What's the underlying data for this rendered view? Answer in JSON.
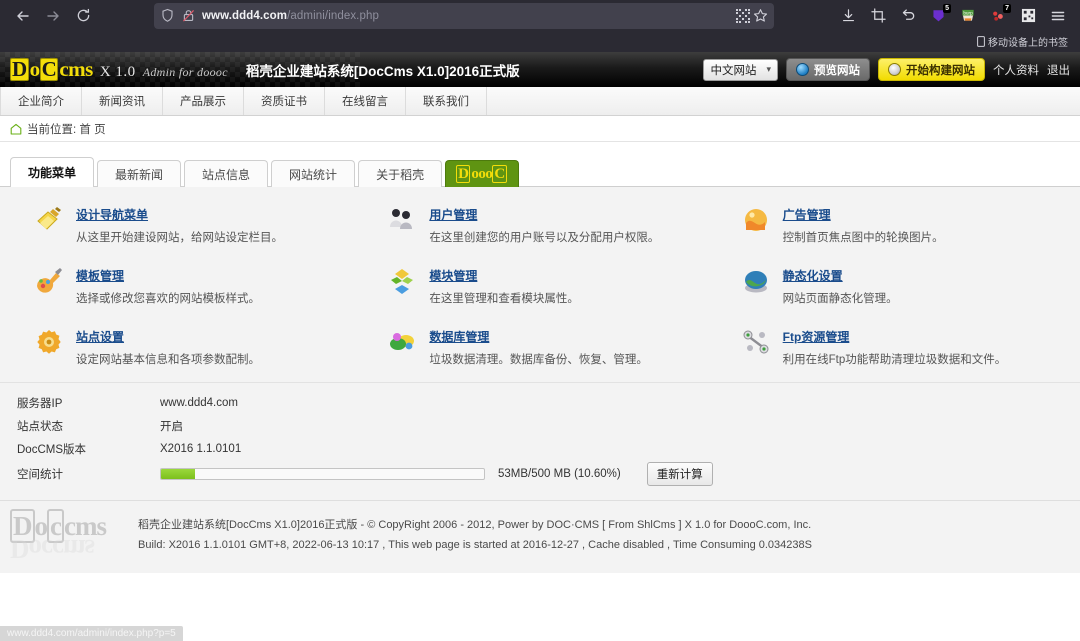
{
  "browser": {
    "back_icon": "back-arrow-icon",
    "forward_icon": "forward-arrow-icon",
    "reload_icon": "reload-icon",
    "url_display_bold": "www.ddd4.com",
    "url_display_rest": "/admini/index.php",
    "url_full": "www.ddd4.com/admini/index.php",
    "shield_icon": "shield-icon",
    "insecure_lock_icon": "lock-crossed-icon",
    "qr_icon": "qr-code-icon",
    "bookmark_star_icon": "star-icon",
    "toolbar_icons": [
      {
        "name": "downloads-icon",
        "badge": ""
      },
      {
        "name": "screenshot-crop-icon",
        "badge": ""
      },
      {
        "name": "undo-arrow-icon",
        "badge": ""
      },
      {
        "name": "extension-purple-icon",
        "badge": "5"
      },
      {
        "name": "burp-extension-icon",
        "badge": ""
      },
      {
        "name": "extension-red-icon",
        "badge": "7"
      },
      {
        "name": "qr-extension-icon",
        "badge": ""
      },
      {
        "name": "hamburger-menu-icon",
        "badge": ""
      }
    ],
    "bookmark_label": "移动设备上的书签",
    "status_url": "www.ddd4.com/admini/index.php?p=5"
  },
  "header": {
    "logo_d": "D",
    "logo_o": "o",
    "logo_c": "C",
    "logo_cms": "cms",
    "version": "X 1.0",
    "subtitle": "Admin for doooc",
    "title": "稻壳企业建站系统[DocCms X1.0]2016正式版",
    "lang_select": "中文网站",
    "lang_caret": "▾",
    "preview_button": "预览网站",
    "build_button": "开始构建网站",
    "profile_link": "个人资料",
    "logout_link": "退出",
    "accent_yellow": "#f3dd0a"
  },
  "site_nav": {
    "items": [
      {
        "label": "企业简介"
      },
      {
        "label": "新闻资讯"
      },
      {
        "label": "产品展示"
      },
      {
        "label": "资质证书"
      },
      {
        "label": "在线留言"
      },
      {
        "label": "联系我们"
      }
    ]
  },
  "breadcrumb": {
    "home_icon": "home-icon",
    "text": "当前位置: 首 页"
  },
  "tabs": [
    {
      "label": "功能菜单",
      "active": true
    },
    {
      "label": "最新新闻",
      "active": false
    },
    {
      "label": "站点信息",
      "active": false
    },
    {
      "label": "网站统计",
      "active": false
    },
    {
      "label": "关于稻壳",
      "active": false
    }
  ],
  "logo_tab": {
    "text_d": "D",
    "text_rest": "ooo",
    "text_c": "C",
    "bg_color": "#5f9412"
  },
  "menu": {
    "items": [
      {
        "icon": "design-nav-icon",
        "title": "设计导航菜单",
        "desc": "从这里开始建设网站，给网站设定栏目。"
      },
      {
        "icon": "user-manage-icon",
        "title": "用户管理",
        "desc": "在这里创建您的用户账号以及分配用户权限。"
      },
      {
        "icon": "ad-manage-icon",
        "title": "广告管理",
        "desc": "控制首页焦点图中的轮换图片。"
      },
      {
        "icon": "template-manage-icon",
        "title": "模板管理",
        "desc": "选择或修改您喜欢的网站模板样式。"
      },
      {
        "icon": "module-manage-icon",
        "title": "模块管理",
        "desc": "在这里管理和查看模块属性。"
      },
      {
        "icon": "static-settings-icon",
        "title": "静态化设置",
        "desc": "网站页面静态化管理。"
      },
      {
        "icon": "site-settings-icon",
        "title": "站点设置",
        "desc": "设定网站基本信息和各项参数配制。"
      },
      {
        "icon": "database-manage-icon",
        "title": "数据库管理",
        "desc": "垃圾数据清理。数据库备份、恢复、管理。"
      },
      {
        "icon": "ftp-manage-icon",
        "title": "Ftp资源管理",
        "desc": "利用在线Ftp功能帮助清理垃圾数据和文件。"
      }
    ]
  },
  "info": {
    "rows": [
      {
        "label": "服务器IP",
        "value": "www.ddd4.com"
      },
      {
        "label": "站点状态",
        "value": "开启"
      },
      {
        "label": "DocCMS版本",
        "value": "X2016 1.1.0101"
      }
    ],
    "storage_label": "空间统计",
    "storage_text": "53MB/500 MB (10.60%)",
    "storage_percent": 10.6,
    "recalc_button": "重新计算",
    "bar_color": "#7cc01c"
  },
  "footer": {
    "logo_d": "D",
    "logo_o": "o",
    "logo_c": "c",
    "logo_cms": "cms",
    "line1": "稻壳企业建站系统[DocCms X1.0]2016正式版 - © CopyRight 2006 - 2012, Power by DOC·CMS [ From ShlCms ] X 1.0 for DoooC.com, Inc.",
    "line2": "Build: X2016 1.1.0101 GMT+8, 2022-06-13 10:17 , This web page is started at 2016-12-27 , Cache disabled , Time Consuming 0.034238S"
  }
}
